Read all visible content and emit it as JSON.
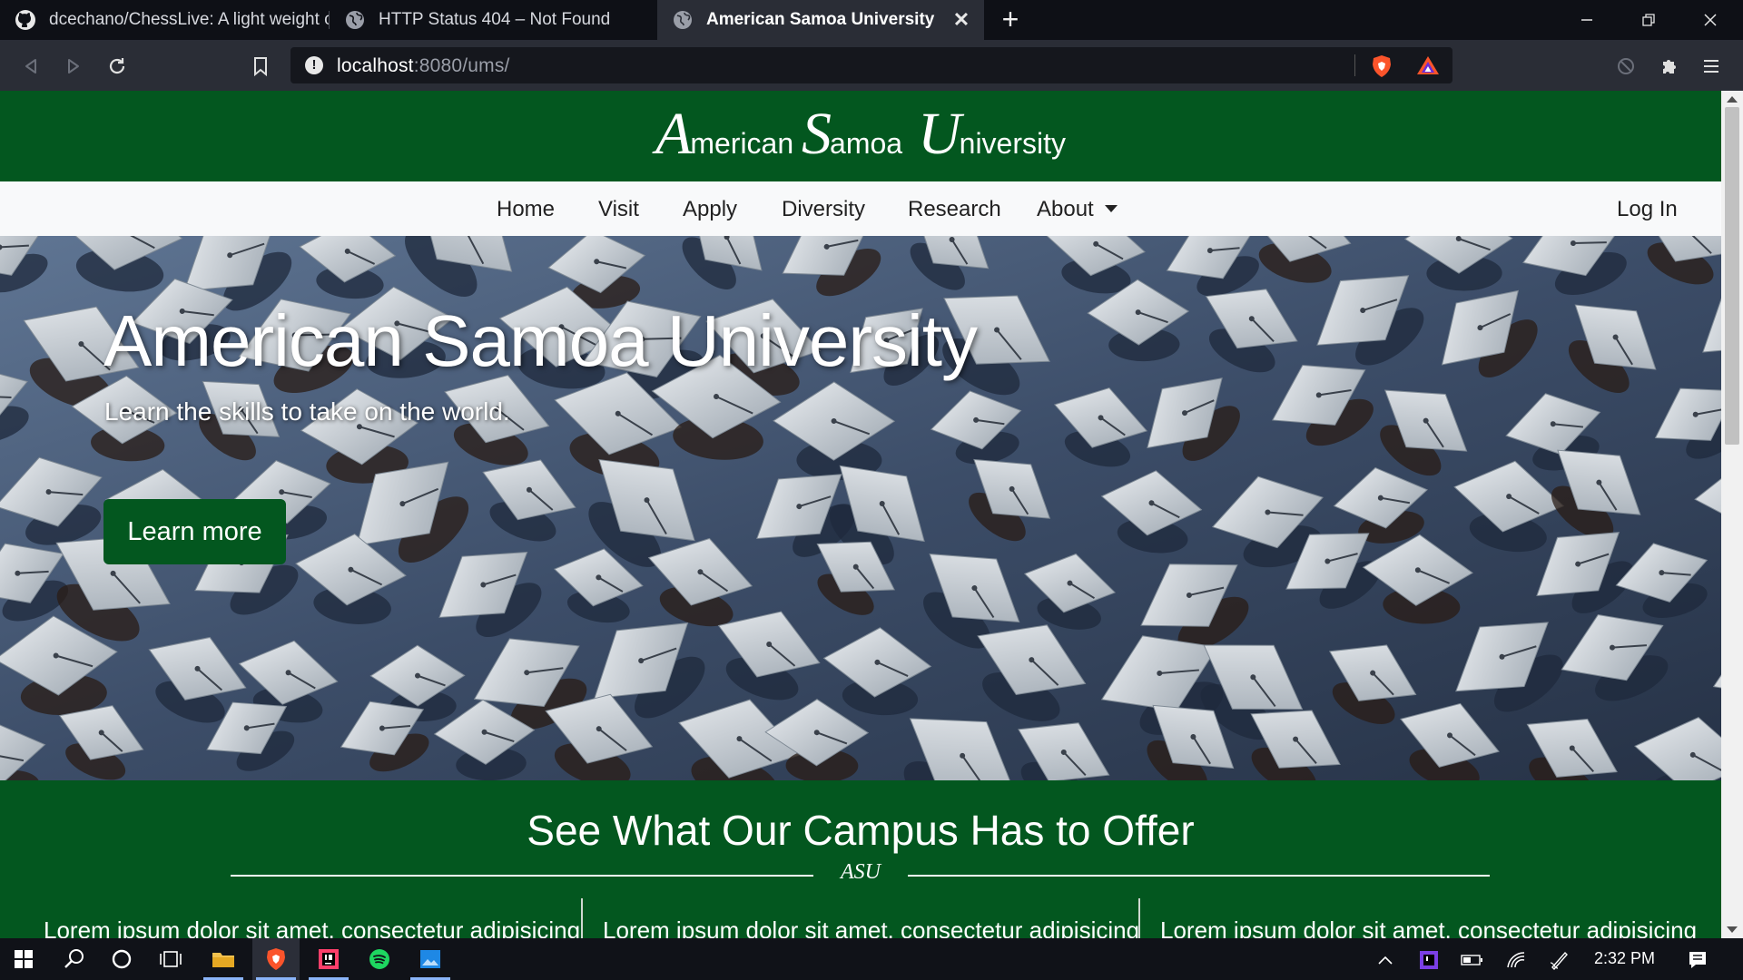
{
  "browser": {
    "tabs": [
      {
        "title": "dcechano/ChessLive: A light weight ch",
        "icon": "github-icon"
      },
      {
        "title": "HTTP Status 404 – Not Found",
        "icon": "globe-icon"
      },
      {
        "title": "American Samoa University",
        "icon": "globe-icon",
        "active": true
      }
    ],
    "url_host": "localhost",
    "url_rest": ":8080/ums/"
  },
  "site": {
    "logo": {
      "part1_cap": "A",
      "part1_rest": "merican",
      "part2_cap": "S",
      "part2_rest": "amoa",
      "part3_cap": "U",
      "part3_rest": "niversity"
    },
    "nav": [
      "Home",
      "Visit",
      "Apply",
      "Diversity",
      "Research",
      "About"
    ],
    "login": "Log In",
    "hero": {
      "title": "American Samoa University",
      "subtitle": "Learn the skills to take on the world.",
      "button": "Learn more"
    },
    "campus": {
      "heading": "See What Our Campus Has to Offer",
      "mark": "ASU",
      "columns": [
        "Lorem ipsum dolor sit amet, consectetur adipisicing",
        "Lorem ipsum dolor sit amet, consectetur adipisicing",
        "Lorem ipsum dolor sit amet, consectetur adipisicing"
      ]
    }
  },
  "taskbar": {
    "time": "2:32 PM"
  },
  "colors": {
    "brand_green": "#03571f",
    "tab_active": "#2a2d36",
    "tab_strip": "#0e1016"
  }
}
